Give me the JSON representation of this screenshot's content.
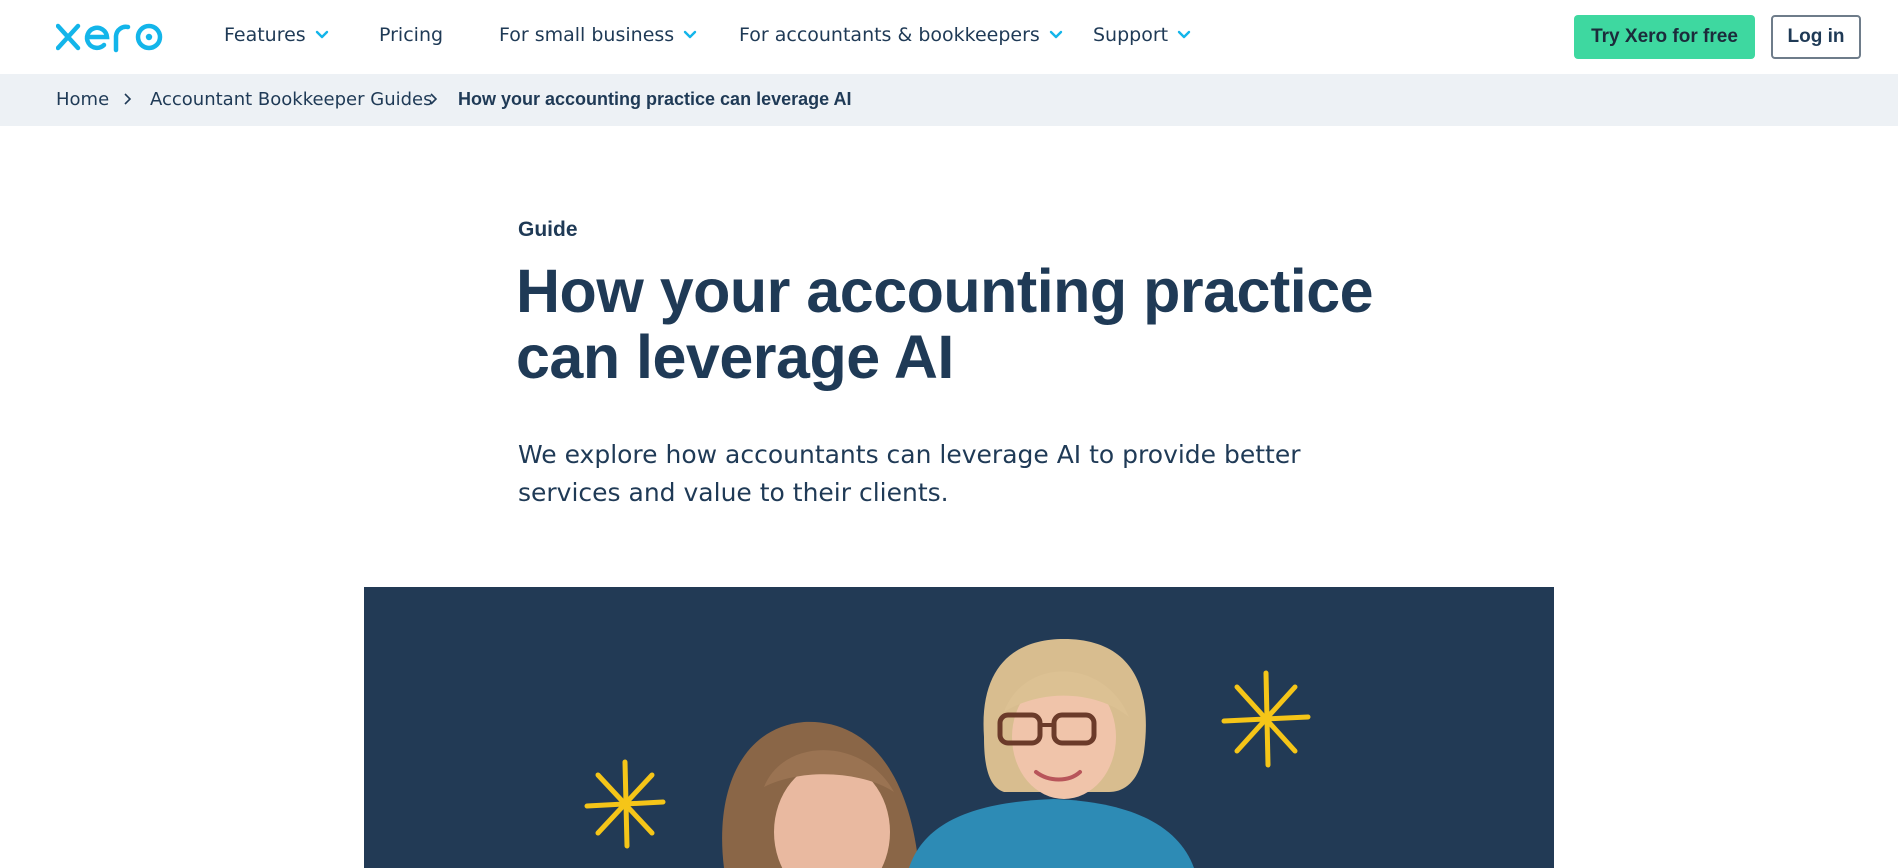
{
  "brand": {
    "logo_text": "xero",
    "logo_color": "#13b5ea"
  },
  "nav": {
    "items": [
      {
        "label": "Features",
        "has_dropdown": true
      },
      {
        "label": "Pricing",
        "has_dropdown": false
      },
      {
        "label": "For small business",
        "has_dropdown": true
      },
      {
        "label": "For accountants & bookkeepers",
        "has_dropdown": true
      },
      {
        "label": "Support",
        "has_dropdown": true
      }
    ],
    "cta_label": "Try Xero for free",
    "login_label": "Log in",
    "cta_color": "#3ed8a0",
    "chevron_color": "#13b5ea"
  },
  "breadcrumb": {
    "items": [
      {
        "label": "Home"
      },
      {
        "label": "Accountant Bookkeeper Guides"
      },
      {
        "label": "How your accounting practice can leverage AI"
      }
    ]
  },
  "article": {
    "eyebrow": "Guide",
    "title": "How your accounting practice can leverage AI",
    "lead": "We explore how accountants can leverage AI to provide better services and value to their clients."
  },
  "hero": {
    "background_color": "#223a55",
    "sparkle_color": "#f5c518",
    "alt": "Two people looking down, smiling"
  }
}
